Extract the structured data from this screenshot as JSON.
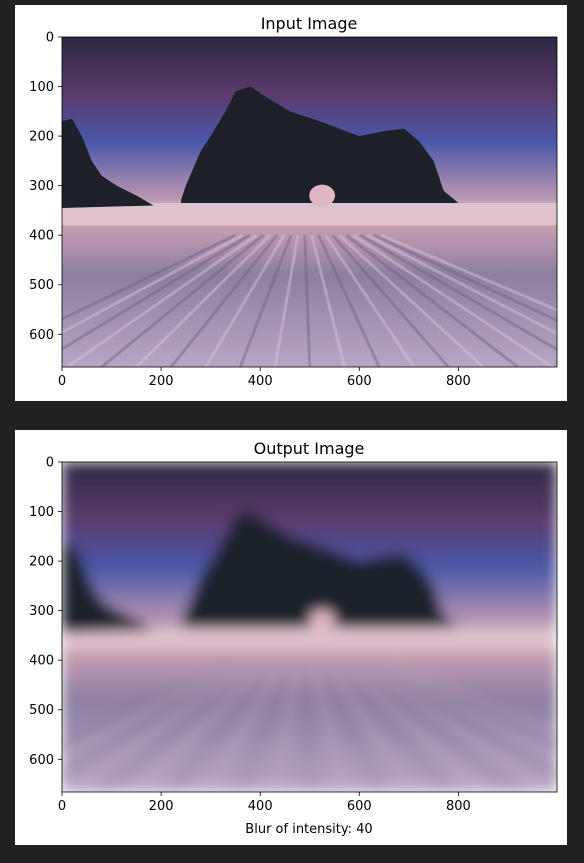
{
  "colors": {
    "page_background": "#212121",
    "panel_background": "#ffffff",
    "sky_top": "#2e2740",
    "sky_purple": "#5a3c6e",
    "sky_blue": "#4a56a8",
    "horizon_pink": "#c89fb2",
    "rock": "#1d2029",
    "water": "#8c7fa0",
    "water_light": "#b7a7c4"
  },
  "chart_data": [
    {
      "type": "image",
      "title": "Input Image",
      "xlabel": "",
      "ylabel": "",
      "xlim": [
        0,
        999
      ],
      "ylim": [
        666,
        0
      ],
      "x_ticks": [
        0,
        200,
        400,
        600,
        800
      ],
      "y_ticks": [
        0,
        100,
        200,
        300,
        400,
        500,
        600
      ],
      "x_tick_labels": [
        "0",
        "200",
        "400",
        "600",
        "800"
      ],
      "y_tick_labels": [
        "0",
        "100",
        "200",
        "300",
        "400",
        "500",
        "600"
      ],
      "blur": 0
    },
    {
      "type": "image",
      "title": "Output Image",
      "xlabel": "Blur of intensity: 40",
      "ylabel": "",
      "xlim": [
        0,
        999
      ],
      "ylim": [
        666,
        0
      ],
      "x_ticks": [
        0,
        200,
        400,
        600,
        800
      ],
      "y_ticks": [
        0,
        100,
        200,
        300,
        400,
        500,
        600
      ],
      "x_tick_labels": [
        "0",
        "200",
        "400",
        "600",
        "800"
      ],
      "y_tick_labels": [
        "0",
        "100",
        "200",
        "300",
        "400",
        "500",
        "600"
      ],
      "blur": 40
    }
  ]
}
